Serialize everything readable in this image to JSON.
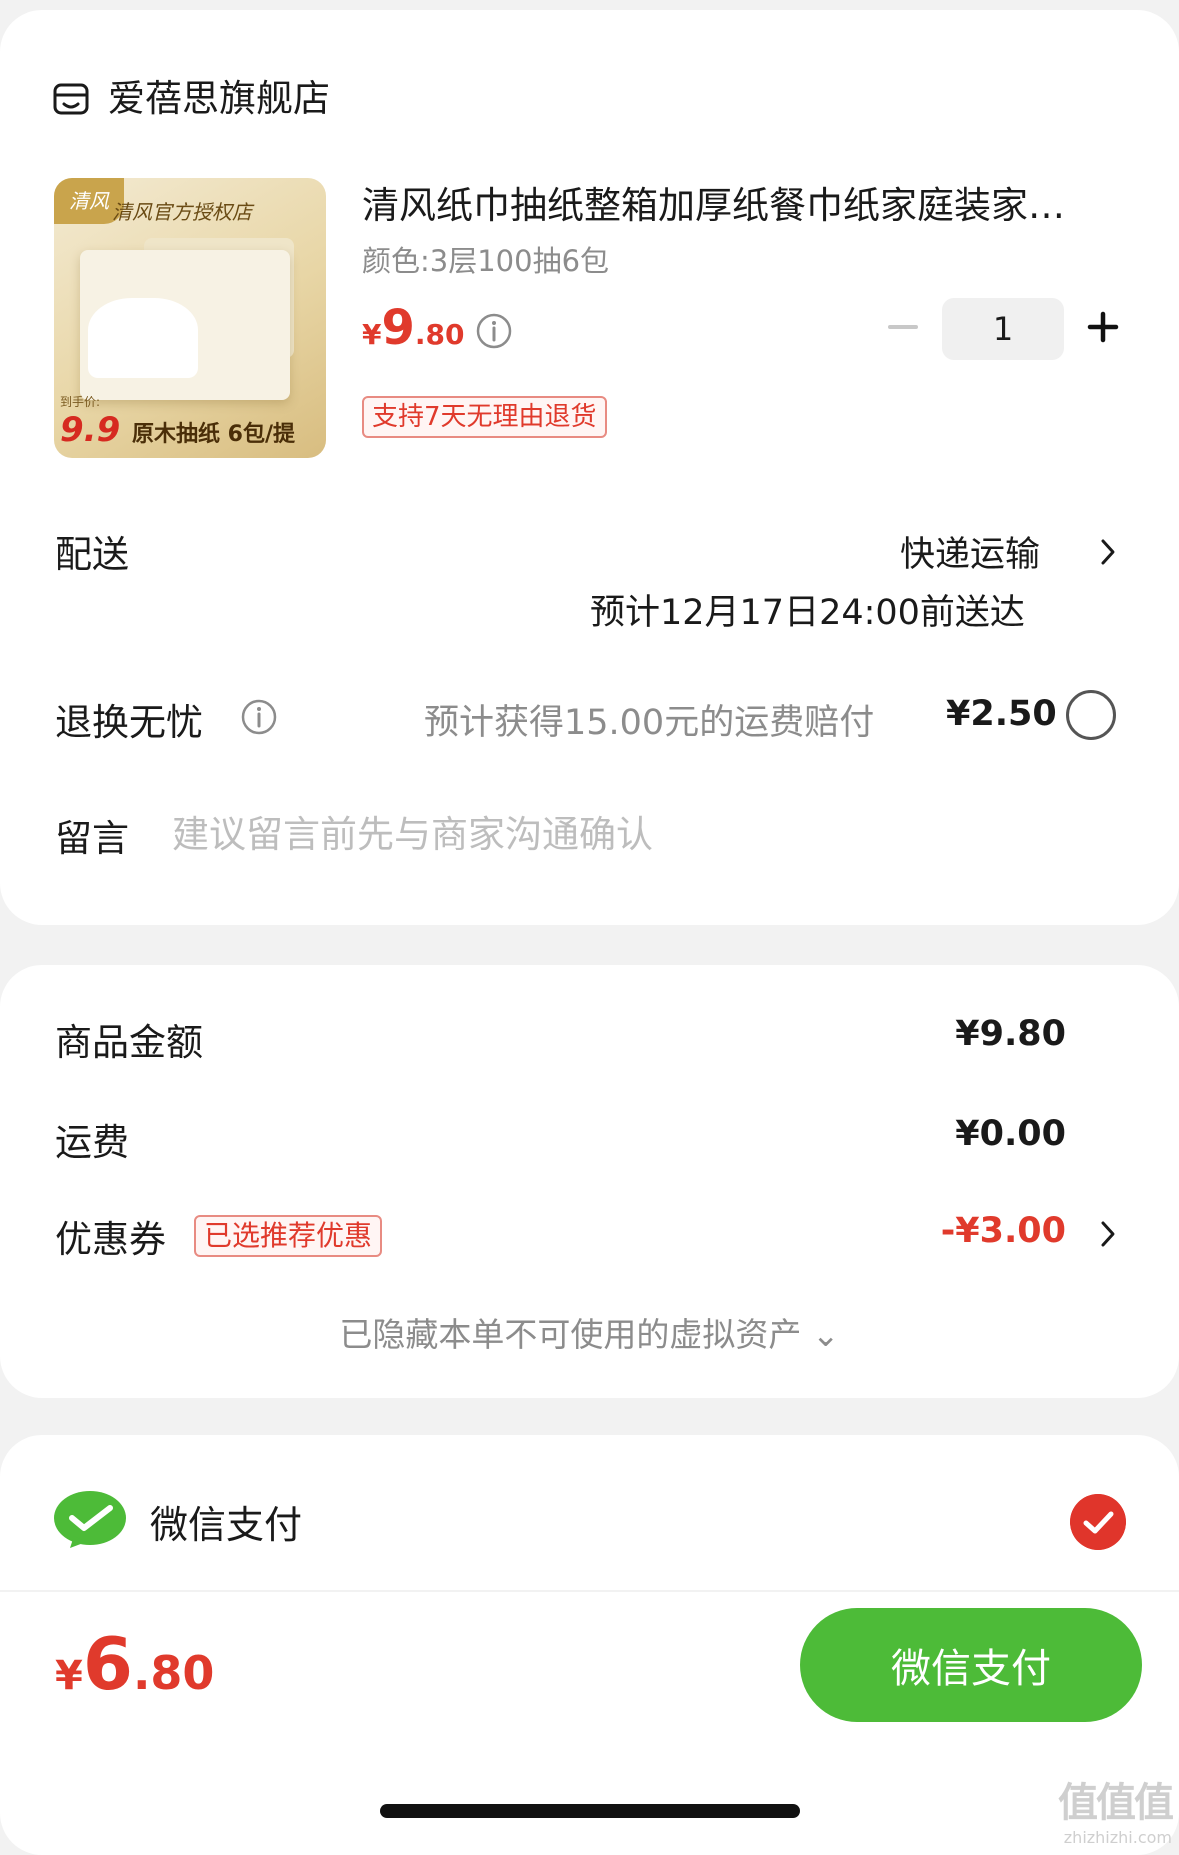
{
  "store": {
    "name": "爱蓓思旗舰店"
  },
  "product": {
    "title": "清风纸巾抽纸整箱加厚纸餐巾纸家庭装家…",
    "spec": "颜色:3层100抽6包",
    "price_yen": "¥",
    "price_int": "9",
    "price_dec": ".80",
    "return_tag": "支持7天无理由退货",
    "quantity": "1",
    "thumb": {
      "badge": "清风",
      "title": "清风官方授权店",
      "price_caption": "到手价:",
      "price": "9.9",
      "desc": "原木抽纸 6包/提"
    }
  },
  "delivery": {
    "label": "配送",
    "method": "快递运输",
    "eta": "预计12月17日24:00前送达"
  },
  "return_insurance": {
    "label": "退换无忧",
    "desc": "预计获得15.00元的运费赔付",
    "price": "¥2.50"
  },
  "message": {
    "label": "留言",
    "placeholder": "建议留言前先与商家沟通确认"
  },
  "summary": {
    "goods_label": "商品金额",
    "goods_value": "¥9.80",
    "shipping_label": "运费",
    "shipping_value": "¥0.00",
    "coupon_label": "优惠券",
    "coupon_tag": "已选推荐优惠",
    "coupon_value": "-¥3.00",
    "hidden_note": "已隐藏本单不可使用的虚拟资产 ⌄"
  },
  "payment": {
    "method_label": "微信支付",
    "total_yen": "¥",
    "total_int": "6",
    "total_dec": ".80",
    "button_label": "微信支付"
  },
  "watermark": {
    "big": "值值值",
    "small": "zhizhizhi.com"
  },
  "colors": {
    "accent_red": "#e03a2c",
    "wechat_green": "#4dbb38",
    "check_red": "#e0352b"
  },
  "icons": [
    "store-icon",
    "info-icon",
    "minus-icon",
    "plus-icon",
    "chevron-right-icon",
    "radio-icon",
    "wechat-icon",
    "check-icon"
  ]
}
